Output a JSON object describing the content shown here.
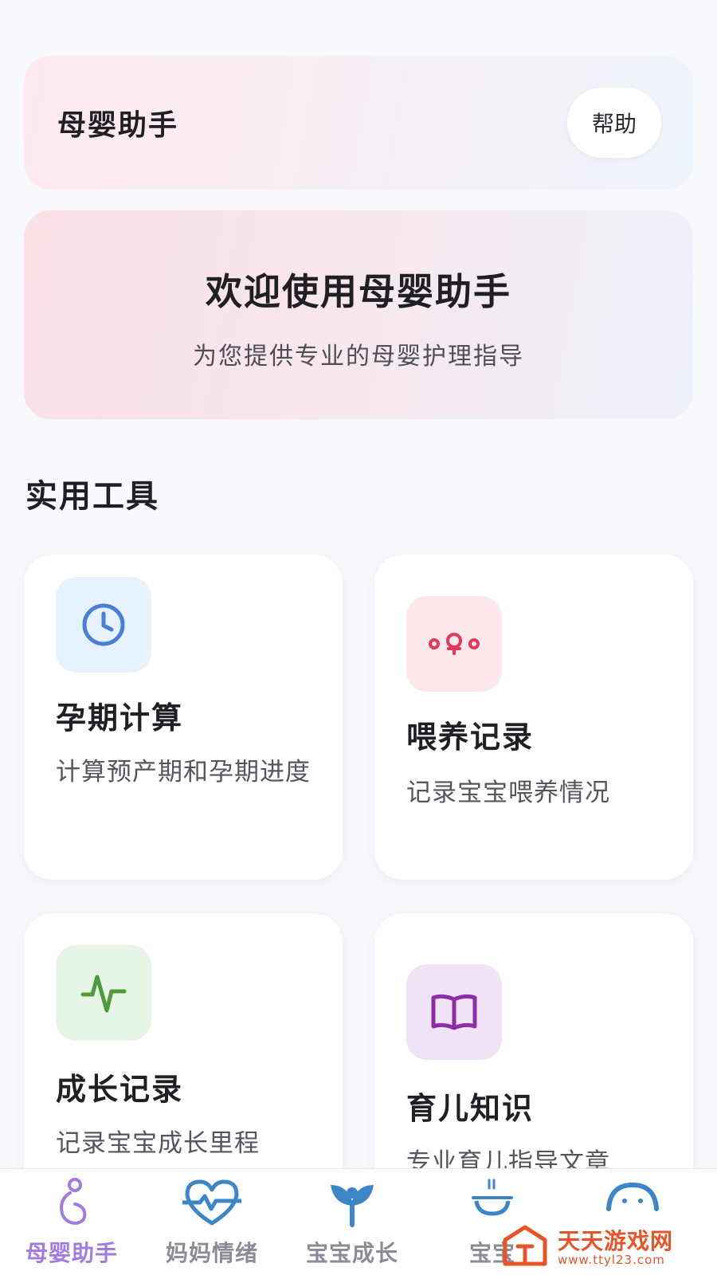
{
  "header": {
    "title": "母婴助手",
    "help_label": "帮助"
  },
  "welcome": {
    "title": "欢迎使用母婴助手",
    "subtitle": "为您提供专业的母婴护理指导"
  },
  "tools_section": {
    "title": "实用工具",
    "cards": [
      {
        "title": "孕期计算",
        "desc": "计算预产期和孕期进度",
        "icon": "clock-icon",
        "icon_bg": "#e6f3ff",
        "icon_color": "#4a7fd6"
      },
      {
        "title": "喂养记录",
        "desc": "记录宝宝喂养情况",
        "icon": "feeding-icon",
        "icon_bg": "#ffe8ec",
        "icon_color": "#e0395a"
      },
      {
        "title": "成长记录",
        "desc": "记录宝宝成长里程",
        "icon": "pulse-icon",
        "icon_bg": "#e6f5e6",
        "icon_color": "#4e9a3c"
      },
      {
        "title": "育儿知识",
        "desc": "专业育儿指导文章",
        "icon": "book-icon",
        "icon_bg": "#f1e3f6",
        "icon_color": "#8a2fa6"
      }
    ]
  },
  "bottom_nav": {
    "items": [
      {
        "label": "母婴助手",
        "icon": "pregnant-icon",
        "active": true
      },
      {
        "label": "妈妈情绪",
        "icon": "heart-pulse-icon",
        "active": false
      },
      {
        "label": "宝宝成长",
        "icon": "sprout-icon",
        "active": false
      },
      {
        "label": "宝宝",
        "icon": "bowl-icon",
        "active": false
      },
      {
        "label": "",
        "icon": "baby-face-icon",
        "active": false
      }
    ]
  },
  "watermark": {
    "text": "天天游戏网",
    "url": "www.ttyl23.com"
  },
  "colors": {
    "accent": "#a27be0",
    "inactive_nav": "#8a8c96",
    "watermark": "#e8542a"
  }
}
